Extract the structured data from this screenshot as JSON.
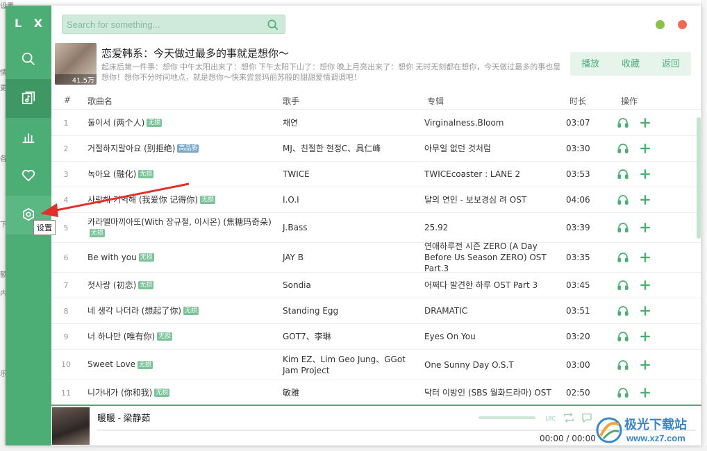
{
  "background_window": {
    "left_fragments": [
      "设置",
      "情",
      "更",
      "各",
      "下",
      "额",
      "内",
      "乐"
    ]
  },
  "sidebar": {
    "logo": "L X",
    "items": [
      {
        "name": "search",
        "icon": "search-icon",
        "active": false
      },
      {
        "name": "song-list",
        "icon": "music-list-icon",
        "active": true
      },
      {
        "name": "leaderboard",
        "icon": "bar-chart-icon",
        "active": false
      },
      {
        "name": "favorites",
        "icon": "heart-icon",
        "active": false
      },
      {
        "name": "settings",
        "icon": "settings-icon",
        "active": false,
        "hovered": true
      }
    ],
    "tooltip": "设置"
  },
  "header": {
    "search_placeholder": "Search for something...",
    "window_controls": [
      {
        "name": "minimize",
        "color": "#8bc34a"
      },
      {
        "name": "close",
        "color": "#f06a4f"
      }
    ]
  },
  "playlist": {
    "title": "恋爱韩系：今天做过最多的事就是想你～",
    "play_count": "41.5万",
    "description": "起床后第一件事：想你 中午太阳出来了：想你 下午太阳下山了：想你 晚上月亮出来了：想你 无时无刻都在想你，今天做过最多的事也是想你！想你不分时间地点，就是想你～快来尝尝玛丽苏般的甜甜爱情调调吧！",
    "actions": [
      "播放",
      "收藏",
      "返回"
    ]
  },
  "table": {
    "columns": [
      "#",
      "歌曲名",
      "歌手",
      "专辑",
      "时长",
      "操作"
    ],
    "rows": [
      {
        "num": "1",
        "name": "둘이서 (两个人)",
        "tag": "无损",
        "singer": "채연",
        "album": "Virginalness.Bloom",
        "duration": "03:07"
      },
      {
        "num": "2",
        "name": "거절하지말아요 (别拒绝)",
        "tag": "高品质",
        "singer": "MJ、친절한 현정C、具仁峰",
        "album": "아무일 없던 것처럼",
        "duration": "03:30"
      },
      {
        "num": "3",
        "name": "녹아요 (融化)",
        "tag": "无损",
        "singer": "TWICE",
        "album": "TWICEcoaster : LANE 2",
        "duration": "03:53"
      },
      {
        "num": "4",
        "name": "사랑해 기억해 (我爱你 记得你)",
        "tag": "无损",
        "singer": "I.O.I",
        "album": "달의 연인 - 보보경심 려 OST",
        "duration": "04:06"
      },
      {
        "num": "5",
        "name": "카라멜마끼아또(With 장규철, 이시온) (焦糖玛奇朵)",
        "tag": "无损",
        "singer": "J.Bass",
        "album": "25.92",
        "duration": "03:39"
      },
      {
        "num": "6",
        "name": "Be with you",
        "tag": "无损",
        "singer": "JAY B",
        "album": "연애하루전 시즌 ZERO (A Day Before Us Season ZERO) OST Part.3",
        "duration": "03:35"
      },
      {
        "num": "7",
        "name": "첫사랑 (初恋)",
        "tag": "无损",
        "singer": "Sondia",
        "album": "어쩌다 발견한 하루 OST Part 3",
        "duration": "03:45"
      },
      {
        "num": "8",
        "name": "네 생각 나더라 (想起了你)",
        "tag": "无损",
        "singer": "Standing Egg",
        "album": "DRAMATIC",
        "duration": "03:51"
      },
      {
        "num": "9",
        "name": "너 하나만 (唯有你)",
        "tag": "无损",
        "singer": "GOT7、李琳",
        "album": "Eyes On You",
        "duration": "03:20"
      },
      {
        "num": "10",
        "name": "Sweet Love",
        "tag": "无损",
        "singer": "Kim EZ、Lim Geo Jung、GGot Jam Project",
        "album": "One Sunny Day O.S.T",
        "duration": "03:00"
      },
      {
        "num": "11",
        "name": "니가내가 (你和我)",
        "tag": "无损",
        "singer": "敏雅",
        "album": "닥터 이방인 (SBS 월화드라마) OST",
        "duration": "02:50"
      }
    ]
  },
  "player": {
    "track": "暖暖 - 梁静茹",
    "time": "00:00 / 00:00",
    "icons": [
      "lyrics-icon",
      "repeat-icon",
      "comment-icon"
    ]
  },
  "watermark": {
    "title": "极光下载站",
    "url": "www.xz7.com"
  },
  "colors": {
    "accent": "#4cae75",
    "accent_dark": "#3f9864",
    "search_bg": "#cfeadb",
    "annotation_arrow": "#e0302b"
  }
}
